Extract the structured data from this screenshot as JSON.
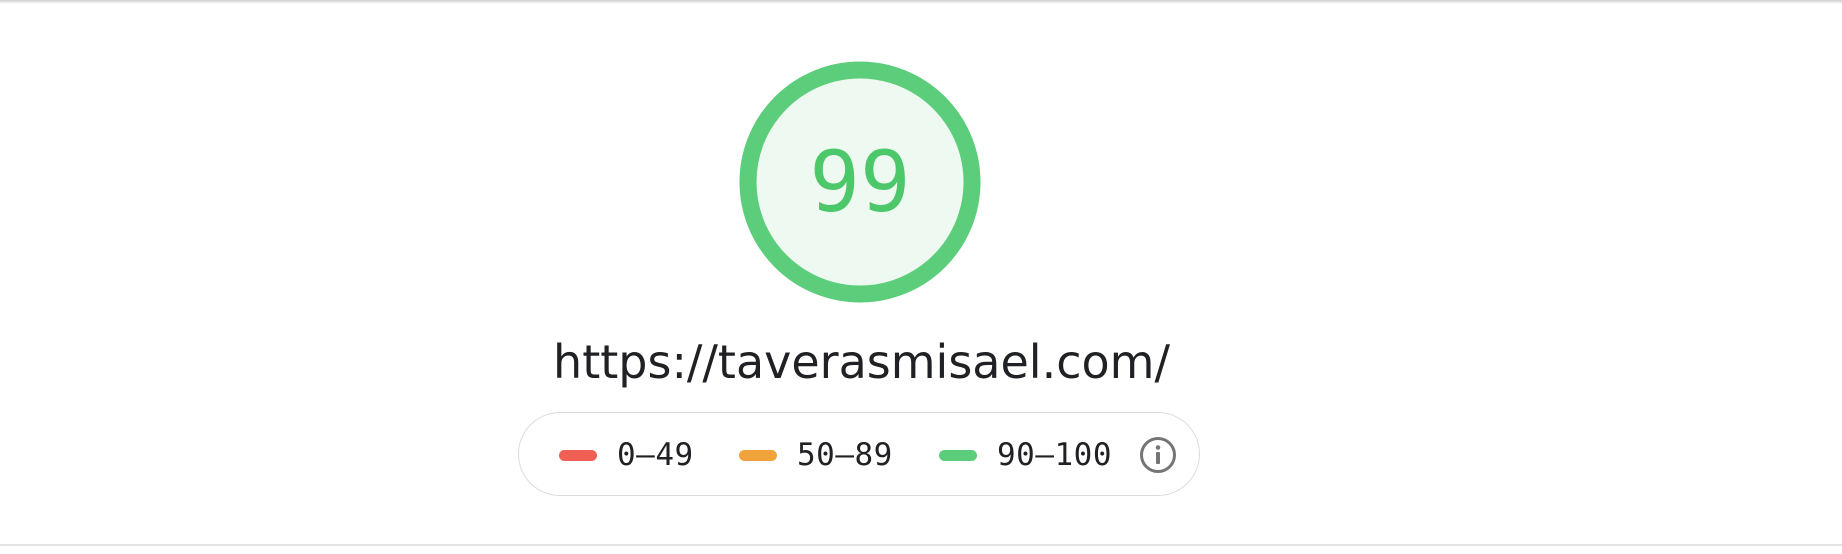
{
  "score": {
    "value": "99",
    "ring_color": "#5ccd7a",
    "fill_color": "#eefaf1",
    "text_color": "#4cc76a"
  },
  "url": "https://taverasmisael.com/",
  "legend": {
    "items": [
      {
        "label": "0–49",
        "color": "#ef5f54"
      },
      {
        "label": "50–89",
        "color": "#f0a33a"
      },
      {
        "label": "90–100",
        "color": "#5ccd7a"
      }
    ],
    "info_icon": "info-icon"
  }
}
